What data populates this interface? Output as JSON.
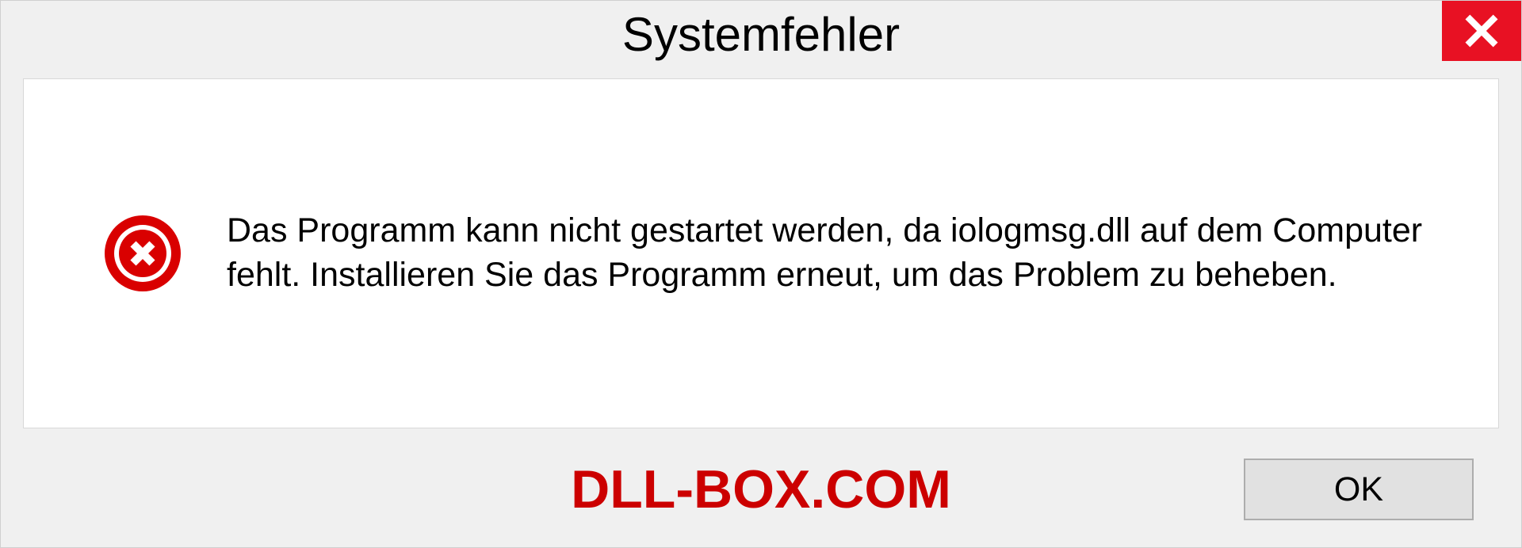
{
  "dialog": {
    "title": "Systemfehler",
    "message": "Das Programm kann nicht gestartet werden, da iologmsg.dll auf dem Computer fehlt. Installieren Sie das Programm erneut, um das Problem zu beheben.",
    "ok_label": "OK",
    "watermark": "DLL-BOX.COM"
  }
}
